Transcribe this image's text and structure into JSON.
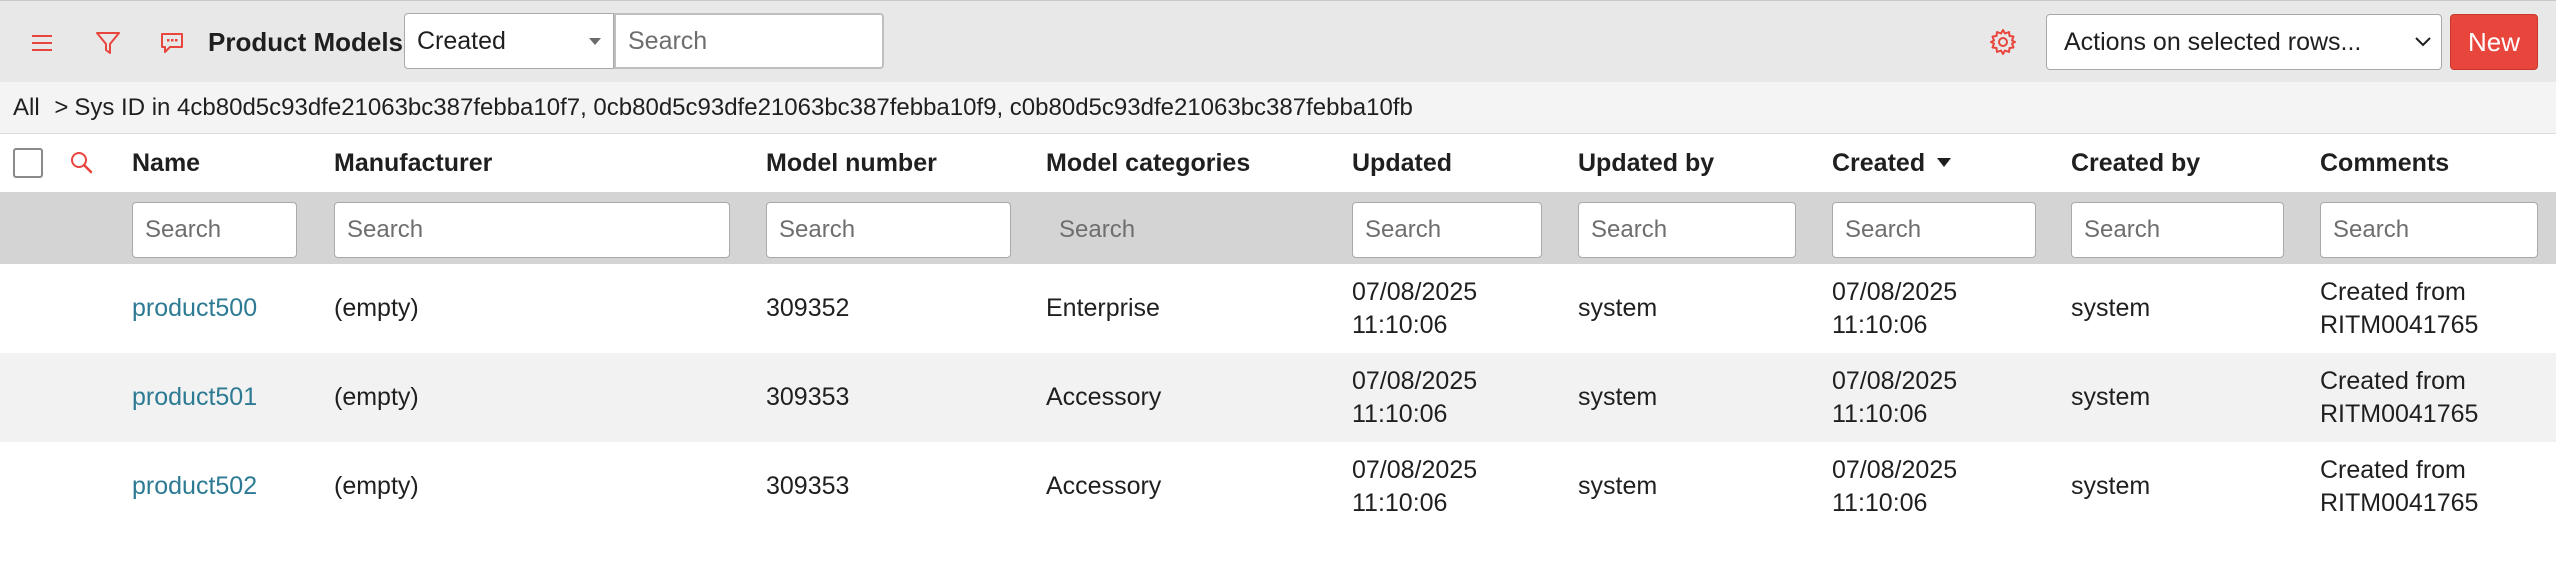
{
  "header": {
    "title": "Product Models",
    "filter_select_value": "Created",
    "search_placeholder": "Search",
    "actions_select_value": "Actions on selected rows...",
    "new_button_label": "New",
    "icons": {
      "menu": "hamburger-menu-icon",
      "filter": "filter-funnel-icon",
      "comments": "chat-bubble-icon",
      "settings": "gear-icon"
    },
    "colors": {
      "accent_icon": "#e8453c",
      "new_button_bg": "#e8453c",
      "link": "#2c7a93"
    }
  },
  "breadcrumb": {
    "root": "All",
    "separator": ">",
    "condition": "Sys ID in 4cb80d5c93dfe21063bc387febba10f7, 0cb80d5c93dfe21063bc387febba10f9, c0b80d5c93dfe21063bc387febba10fb"
  },
  "columns": [
    {
      "label": "Name"
    },
    {
      "label": "Manufacturer"
    },
    {
      "label": "Model number"
    },
    {
      "label": "Model categories"
    },
    {
      "label": "Updated"
    },
    {
      "label": "Updated by"
    },
    {
      "label": "Created",
      "sort": "descending"
    },
    {
      "label": "Created by"
    },
    {
      "label": "Comments"
    }
  ],
  "filter_placeholder": "Search",
  "rows": [
    {
      "name": "product500",
      "manufacturer": "(empty)",
      "model_number": "309352",
      "model_categories": "Enterprise",
      "updated_date": "07/08/2025",
      "updated_time": "11:10:06",
      "updated_by": "system",
      "created_date": "07/08/2025",
      "created_time": "11:10:06",
      "created_by": "system",
      "comments_line1": "Created from",
      "comments_line2": "RITM0041765"
    },
    {
      "name": "product501",
      "manufacturer": "(empty)",
      "model_number": "309353",
      "model_categories": "Accessory",
      "updated_date": "07/08/2025",
      "updated_time": "11:10:06",
      "updated_by": "system",
      "created_date": "07/08/2025",
      "created_time": "11:10:06",
      "created_by": "system",
      "comments_line1": "Created from",
      "comments_line2": "RITM0041765"
    },
    {
      "name": "product502",
      "manufacturer": "(empty)",
      "model_number": "309353",
      "model_categories": "Accessory",
      "updated_date": "07/08/2025",
      "updated_time": "11:10:06",
      "updated_by": "system",
      "created_date": "07/08/2025",
      "created_time": "11:10:06",
      "created_by": "system",
      "comments_line1": "Created from",
      "comments_line2": "RITM0041765"
    }
  ]
}
